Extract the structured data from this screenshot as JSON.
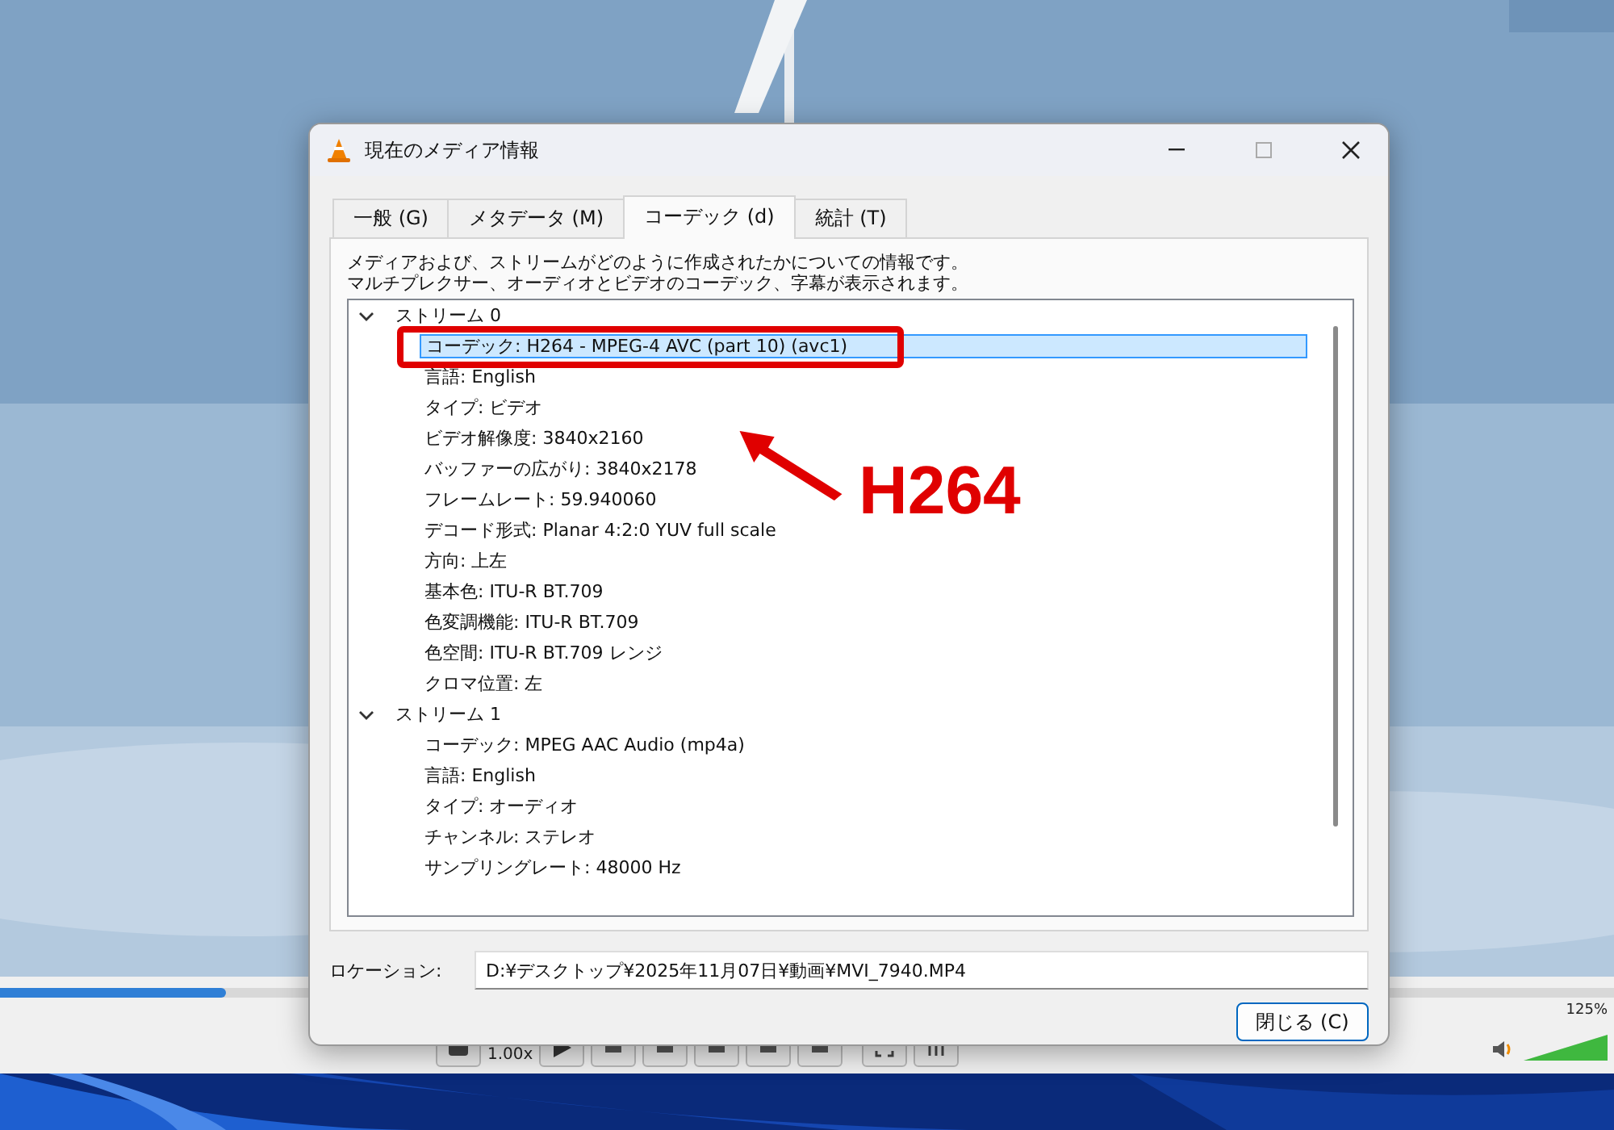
{
  "window": {
    "title": "現在のメディア情報"
  },
  "tabs": [
    {
      "label": "一般 (G)",
      "selected": false
    },
    {
      "label": "メタデータ (M)",
      "selected": false
    },
    {
      "label": "コーデック (d)",
      "selected": true
    },
    {
      "label": "統計 (T)",
      "selected": false
    }
  ],
  "description": [
    "メディアおよび、ストリームがどのように作成されたかについての情報です。",
    "マルチプレクサー、オーディオとビデオのコーデック、字幕が表示されます。"
  ],
  "tree": [
    {
      "label": "ストリーム 0",
      "expanded": true,
      "children": [
        {
          "label": "コーデック: H264 - MPEG-4 AVC (part 10) (avc1)",
          "selected": true
        },
        {
          "label": "言語: English",
          "selected": false
        },
        {
          "label": "タイプ: ビデオ",
          "selected": false
        },
        {
          "label": "ビデオ解像度: 3840x2160",
          "selected": false
        },
        {
          "label": "バッファーの広がり: 3840x2178",
          "selected": false
        },
        {
          "label": "フレームレート: 59.940060",
          "selected": false
        },
        {
          "label": "デコード形式: Planar 4:2:0 YUV full scale",
          "selected": false
        },
        {
          "label": "方向: 上左",
          "selected": false
        },
        {
          "label": "基本色: ITU-R BT.709",
          "selected": false
        },
        {
          "label": "色変調機能: ITU-R BT.709",
          "selected": false
        },
        {
          "label": "色空間: ITU-R BT.709 レンジ",
          "selected": false
        },
        {
          "label": "クロマ位置: 左",
          "selected": false
        }
      ]
    },
    {
      "label": "ストリーム 1",
      "expanded": true,
      "children": [
        {
          "label": "コーデック: MPEG AAC Audio (mp4a)",
          "selected": false
        },
        {
          "label": "言語: English",
          "selected": false
        },
        {
          "label": "タイプ: オーディオ",
          "selected": false
        },
        {
          "label": "チャンネル: ステレオ",
          "selected": false
        },
        {
          "label": "サンプリングレート: 48000 Hz",
          "selected": false
        }
      ]
    }
  ],
  "location": {
    "label": "ロケーション:",
    "value": "D:¥デスクトップ¥2025年11月07日¥動画¥MVI_7940.MP4"
  },
  "close_button": "閉じる (C)",
  "annotation": {
    "text": "H264"
  },
  "player": {
    "progress": {
      "level": 0.14
    },
    "speed": "1.00x",
    "volume": {
      "reading": "125%",
      "level": 1
    }
  }
}
